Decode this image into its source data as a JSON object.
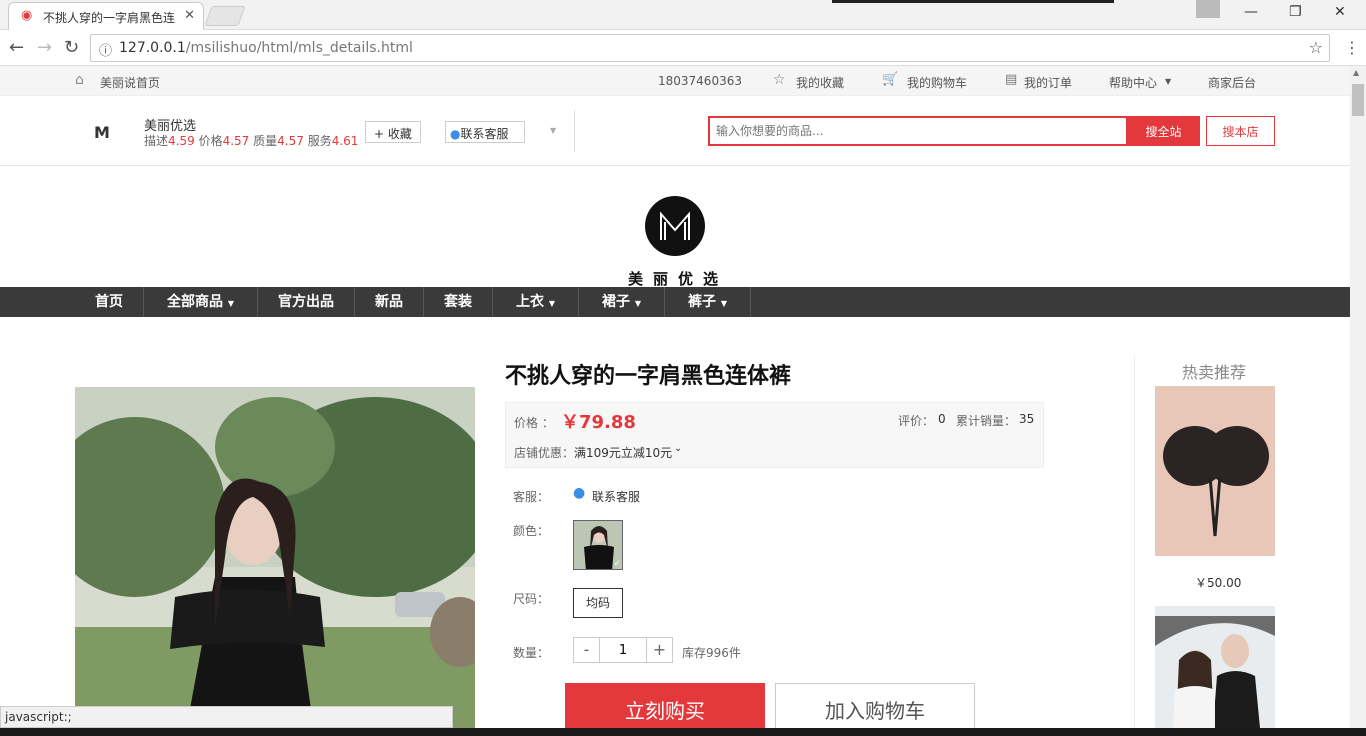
{
  "browser": {
    "tab_title": "不挑人穿的一字肩黑色连",
    "url_host": "127.0.0.1",
    "url_path": "/msilishuo/html/mls_details.html",
    "status_text": "javascript:;"
  },
  "topbar": {
    "home": "美丽说首页",
    "phone": "18037460363",
    "favorites": "我的收藏",
    "cart": "我的购物车",
    "orders": "我的订单",
    "help": "帮助中心",
    "merchant": "商家后台"
  },
  "shop": {
    "name": "美丽优选",
    "rating_desc_label": "描述",
    "rating_desc": "4.59",
    "rating_price_label": "价格",
    "rating_price": "4.57",
    "rating_quality_label": "质量",
    "rating_quality": "4.57",
    "rating_service_label": "服务",
    "rating_service": "4.61",
    "favorite_btn": "+ 收藏",
    "contact_btn": "联系客服",
    "search_placeholder": "输入你想要的商品...",
    "search_all": "搜全站",
    "search_shop": "搜本店",
    "logo_text": "美丽优选"
  },
  "nav": [
    {
      "label": "首页",
      "dropdown": false
    },
    {
      "label": "全部商品",
      "dropdown": true
    },
    {
      "label": "官方出品",
      "dropdown": false
    },
    {
      "label": "新品",
      "dropdown": false
    },
    {
      "label": "套装",
      "dropdown": false
    },
    {
      "label": "上衣",
      "dropdown": true
    },
    {
      "label": "裙子",
      "dropdown": true
    },
    {
      "label": "裤子",
      "dropdown": true
    }
  ],
  "product": {
    "title": "不挑人穿的一字肩黑色连体裤",
    "price_label": "价格 ：",
    "price": "￥79.88",
    "review_label": "评价：",
    "review_count": "0",
    "sales_label": "累计销量：",
    "sales_count": "35",
    "promo_label": "店铺优惠：",
    "promo_text": "满109元立减10元",
    "service_label": "客服：",
    "service_text": "联系客服",
    "color_label": "颜色：",
    "size_label": "尺码：",
    "size_value": "均码",
    "qty_label": "数量：",
    "qty_value": "1",
    "stock_text": "库存996件",
    "buy_now": "立刻购买",
    "add_cart": "加入购物车"
  },
  "hot": {
    "title": "热卖推荐",
    "items": [
      {
        "price": "￥50.00"
      }
    ]
  },
  "colors": {
    "accent": "#e4393c",
    "nav_bg": "#3a3a3a"
  }
}
